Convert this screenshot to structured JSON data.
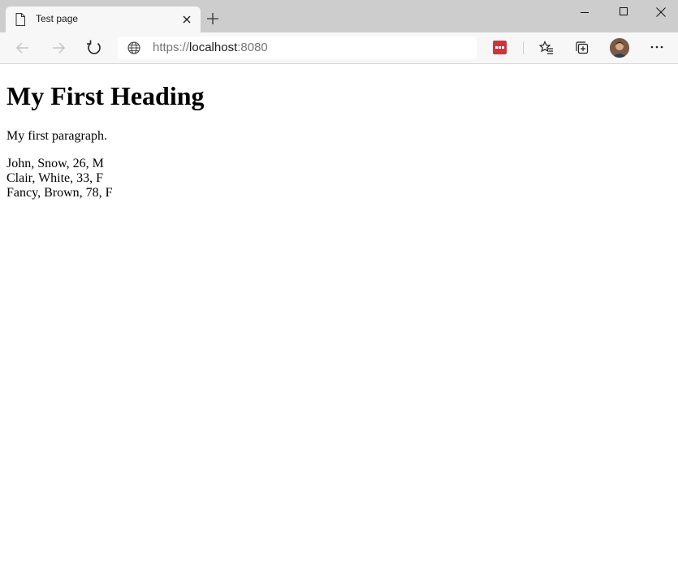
{
  "browser": {
    "tab": {
      "title": "Test page"
    },
    "address_bar": {
      "scheme": "https://",
      "host": "localhost",
      "port": ":8080"
    }
  },
  "page": {
    "heading": "My First Heading",
    "paragraph": "My first paragraph.",
    "rows": [
      "John, Snow, 26, M",
      "Clair, White, 33, F",
      "Fancy, Brown, 78, F"
    ]
  }
}
